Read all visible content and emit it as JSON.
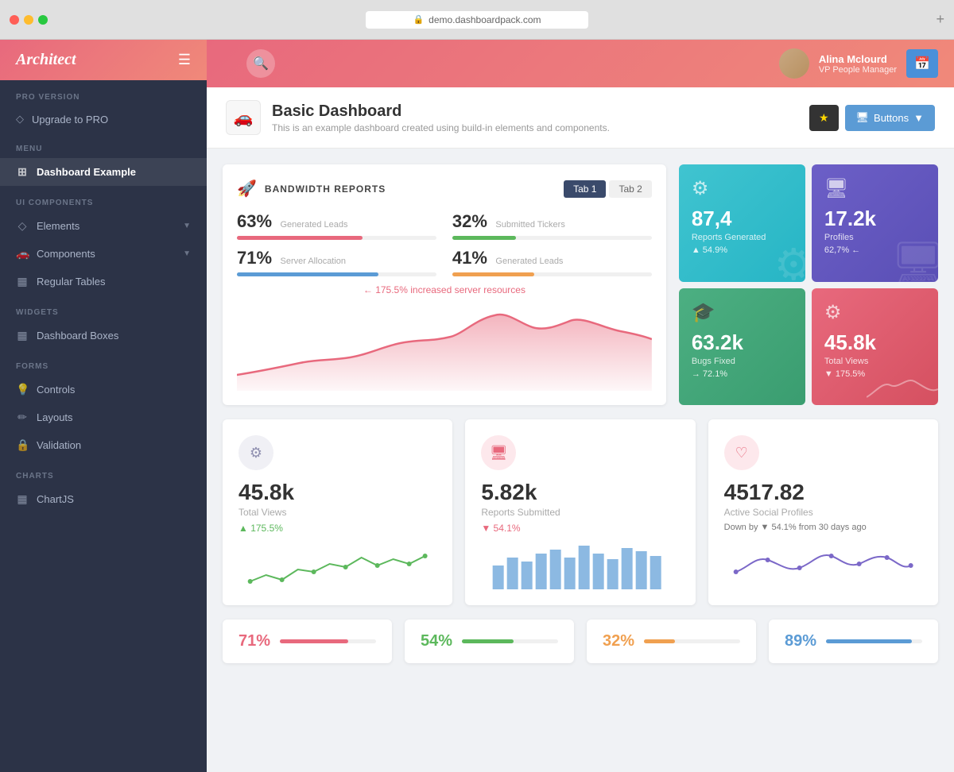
{
  "browser": {
    "url": "demo.dashboardpack.com",
    "add_tab": "+"
  },
  "header": {
    "brand": "Architect",
    "user_name": "Alina Mclourd",
    "user_role": "VP People Manager"
  },
  "sidebar": {
    "pro_version_label": "PRO VERSION",
    "upgrade_label": "Upgrade to PRO",
    "menu_label": "MENU",
    "dashboard_example_label": "Dashboard Example",
    "ui_components_label": "UI COMPONENTS",
    "elements_label": "Elements",
    "components_label": "Components",
    "regular_tables_label": "Regular Tables",
    "widgets_label": "WIDGETS",
    "dashboard_boxes_label": "Dashboard Boxes",
    "forms_label": "FORMS",
    "controls_label": "Controls",
    "layouts_label": "Layouts",
    "validation_label": "Validation",
    "charts_label": "CHARTS",
    "chartjs_label": "ChartJS"
  },
  "page": {
    "title": "Basic Dashboard",
    "subtitle": "This is an example dashboard created using build-in elements and components.",
    "buttons_label": "Buttons"
  },
  "bandwidth": {
    "title": "BANDWIDTH REPORTS",
    "tab1": "Tab 1",
    "tab2": "Tab 2",
    "stat1_value": "63%",
    "stat1_label": "Generated Leads",
    "stat2_value": "32%",
    "stat2_label": "Submitted Tickers",
    "stat3_value": "71%",
    "stat3_label": "Server Allocation",
    "stat4_value": "41%",
    "stat4_label": "Generated Leads",
    "alert_text": "175.5% increased server resources"
  },
  "stat_boxes": {
    "box1_value": "87,4",
    "box1_label": "Reports Generated",
    "box1_change": "▲ 54.9%",
    "box2_value": "17.2k",
    "box2_label": "Profiles",
    "box2_change": "62,7% ←",
    "box3_value": "63.2k",
    "box3_label": "Bugs Fixed",
    "box3_change": "→ 72.1%",
    "box4_value": "45.8k",
    "box4_label": "Total Views",
    "box4_change": "▼ 175.5%"
  },
  "bottom_cards": {
    "card1_value": "45.8k",
    "card1_label": "Total Views",
    "card1_change": "▲ 175.5%",
    "card2_value": "5.82k",
    "card2_label": "Reports Submitted",
    "card2_change": "▼ 54.1%",
    "card3_value": "4517.82",
    "card3_label": "Active Social Profiles",
    "card3_change": "Down by ▼ 54.1% from 30 days ago"
  },
  "progress_cards": {
    "p1_pct": "71%",
    "p2_pct": "54%",
    "p3_pct": "32%",
    "p4_pct": "89%"
  }
}
